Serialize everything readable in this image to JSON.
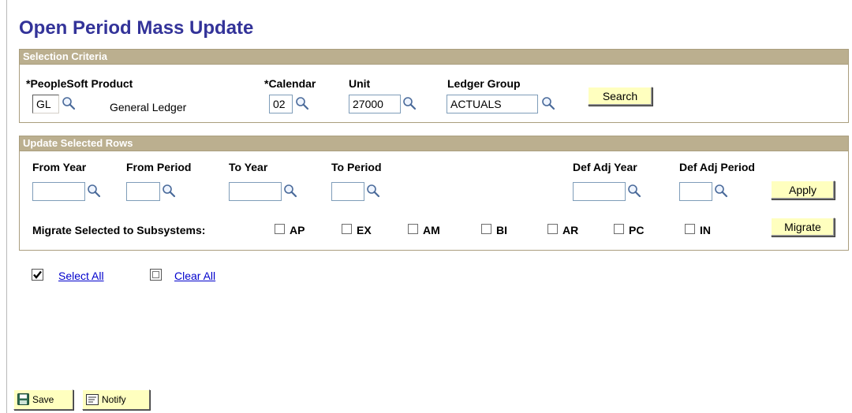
{
  "page": {
    "title": "Open Period Mass Update"
  },
  "selection": {
    "header": "Selection Criteria",
    "product_label": "*PeopleSoft Product",
    "product_value": "GL",
    "product_desc": "General Ledger",
    "calendar_label": "*Calendar",
    "calendar_value": "02",
    "unit_label": "Unit",
    "unit_value": "27000",
    "ledger_label": "Ledger Group",
    "ledger_value": "ACTUALS",
    "search_button": "Search"
  },
  "update": {
    "header": "Update Selected Rows",
    "from_year_label": "From Year",
    "from_period_label": "From Period",
    "to_year_label": "To Year",
    "to_period_label": "To Period",
    "def_adj_year_label": "Def Adj Year",
    "def_adj_period_label": "Def Adj Period",
    "from_year_value": "",
    "from_period_value": "",
    "to_year_value": "",
    "to_period_value": "",
    "def_adj_year_value": "",
    "def_adj_period_value": "",
    "apply_button": "Apply",
    "migrate_label": "Migrate Selected to Subsystems:",
    "subsystems": [
      {
        "label": "AP",
        "checked": false
      },
      {
        "label": "EX",
        "checked": false
      },
      {
        "label": "AM",
        "checked": false
      },
      {
        "label": "BI",
        "checked": false
      },
      {
        "label": "AR",
        "checked": false
      },
      {
        "label": "PC",
        "checked": false
      },
      {
        "label": "IN",
        "checked": false
      }
    ],
    "migrate_button": "Migrate"
  },
  "links": {
    "select_all": "Select All",
    "clear_all": "Clear All"
  },
  "footer": {
    "save_button": "Save",
    "notify_button": "Notify"
  },
  "icons": {
    "lookup": "magnifier-lookup-icon",
    "save": "floppy-disk-icon",
    "notify": "notify-note-icon"
  },
  "colors": {
    "title": "#333399",
    "group_header": "#bbaf8f",
    "button_bg": "#ffffbf",
    "link": "#0000cc"
  }
}
